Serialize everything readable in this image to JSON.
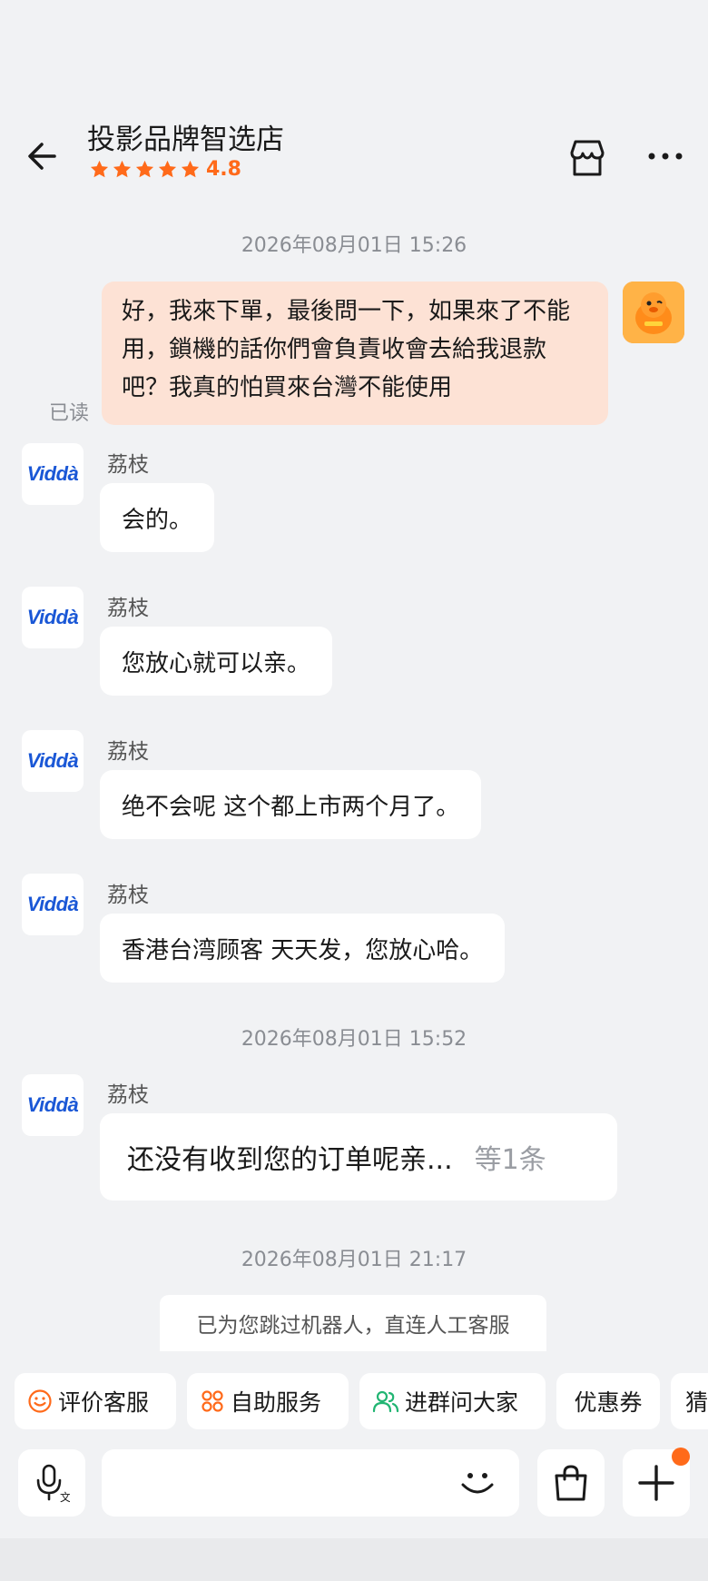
{
  "header": {
    "shop_name": "投影品牌智选店",
    "rating": "4.8",
    "accent": "#ff6a1a"
  },
  "messages": {
    "ts1": "2026年08月01日 15:26",
    "my_message": "好，我來下單，最後問一下，如果來了不能用，鎖機的話你們會負責收會去給我退款吧？我真的怕買來台灣不能使用",
    "read_status": "已读",
    "sender": "荔枝",
    "brand_logo": "Viddà",
    "m1": "会的。",
    "m2": "您放心就可以亲。",
    "m3": "绝不会呢 这个都上市两个月了。",
    "m4": "香港台湾顾客 天天发，您放心哈。",
    "ts2": "2026年08月01日 15:52",
    "m5": "还没有收到您的订单呢亲...",
    "m5_more": "等1条",
    "ts3": "2026年08月01日 21:17",
    "notice": "已为您跳过机器人，直连人工客服"
  },
  "quick_actions": {
    "rate": "评价客服",
    "self_service": "自助服务",
    "group": "进群问大家",
    "coupon": "优惠券",
    "guess": "猜"
  },
  "input": {
    "placeholder": ""
  }
}
